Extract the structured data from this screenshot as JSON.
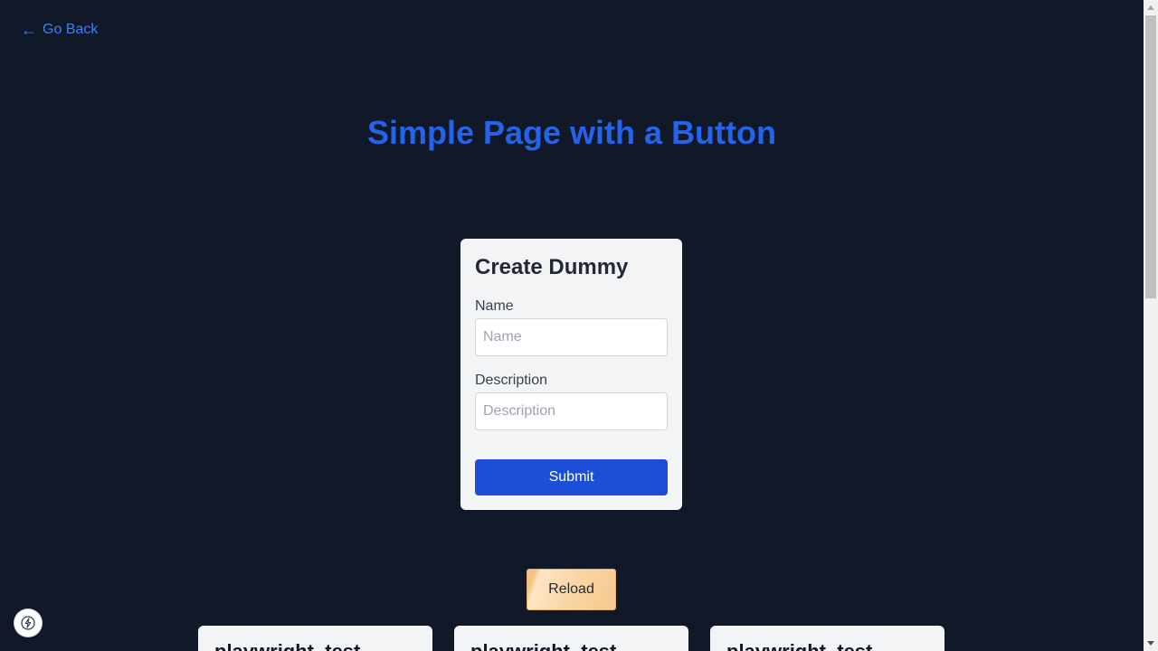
{
  "nav": {
    "back_arrow": "←",
    "back_label": "Go Back"
  },
  "header": {
    "title": "Simple Page with a Button"
  },
  "form": {
    "title": "Create Dummy",
    "name_label": "Name",
    "name_placeholder": "Name",
    "name_value": "",
    "description_label": "Description",
    "description_placeholder": "Description",
    "description_value": "",
    "submit_label": "Submit"
  },
  "reload": {
    "label": "Reload"
  },
  "items": [
    {
      "title": "playwright_test"
    },
    {
      "title": "playwright_test"
    },
    {
      "title": "playwright_test"
    }
  ],
  "badge": {
    "icon": "lightning-icon"
  },
  "colors": {
    "background": "#111827",
    "accent": "#2563eb",
    "link": "#3b82f6",
    "submit": "#1d4ed8",
    "card": "#f3f4f6"
  }
}
